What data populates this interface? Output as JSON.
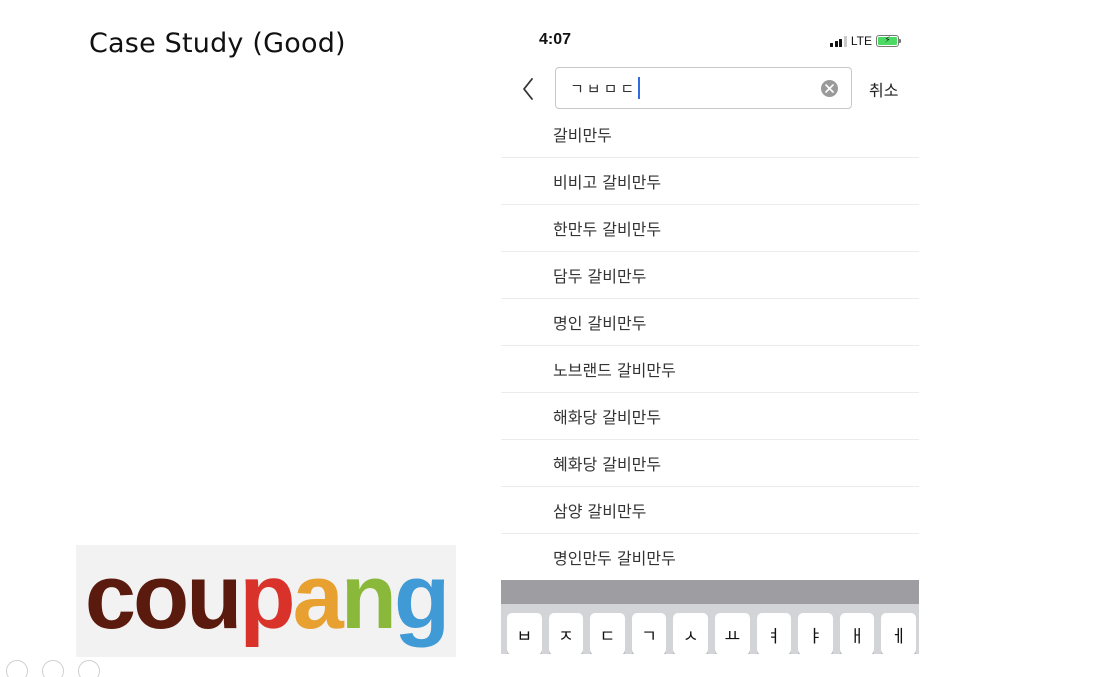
{
  "slide": {
    "title": "Case Study (Good)",
    "logo": {
      "letters": [
        "c",
        "o",
        "u",
        "p",
        "a",
        "n",
        "g"
      ],
      "colors": [
        "#5a1a0e",
        "#5a1a0e",
        "#5a1a0e",
        "#d8322b",
        "#e8a131",
        "#8ab83a",
        "#3f9ad6"
      ]
    }
  },
  "phone": {
    "status": {
      "time": "4:07",
      "network": "LTE",
      "signal_bars": 4,
      "signal_bars_active": 3,
      "battery_charging_icon": "bolt-icon"
    },
    "search": {
      "back_icon": "chevron-left-icon",
      "query": "ㄱㅂㅁㄷ",
      "clear_icon": "clear-circle-icon",
      "cancel_label": "취소"
    },
    "suggestions": [
      "갈비만두",
      "비비고 갈비만두",
      "한만두 갈비만두",
      "담두 갈비만두",
      "명인 갈비만두",
      "노브랜드 갈비만두",
      "해화당 갈비만두",
      "혜화당 갈비만두",
      "삼양 갈비만두",
      "명인만두 갈비만두"
    ],
    "keyboard": {
      "row1": [
        "ㅂ",
        "ㅈ",
        "ㄷ",
        "ㄱ",
        "ㅅ",
        "ㅛ",
        "ㅕ",
        "ㅑ",
        "ㅐ",
        "ㅔ"
      ]
    }
  }
}
